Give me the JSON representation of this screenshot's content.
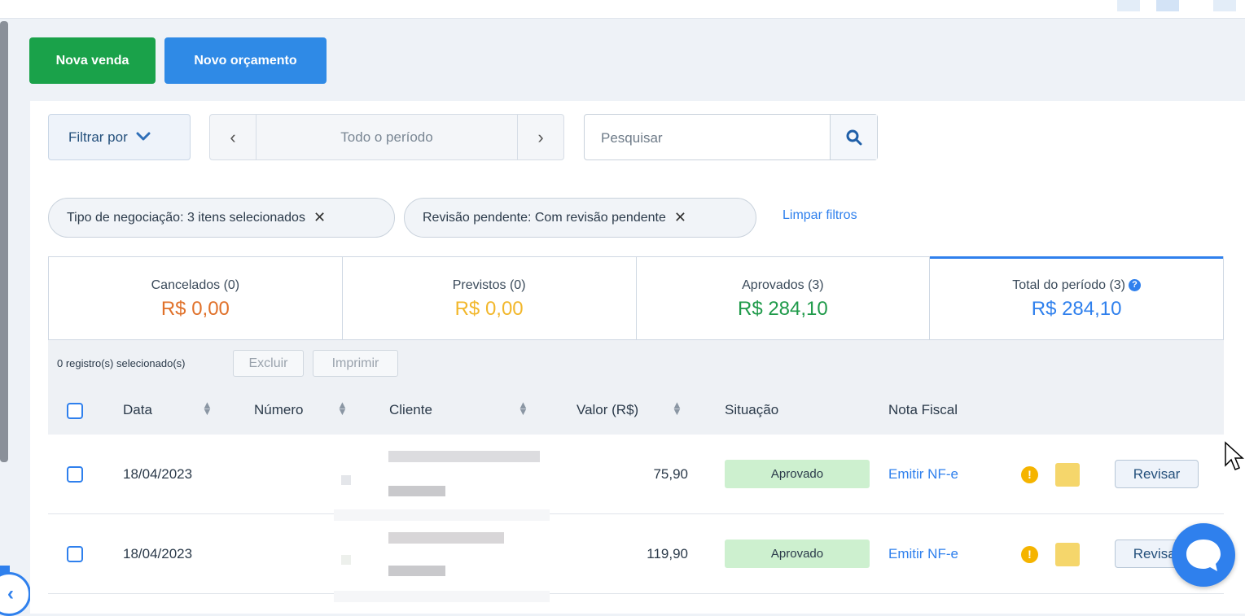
{
  "actions": {
    "new_sale": "Nova venda",
    "new_quote": "Novo orçamento"
  },
  "filters": {
    "filter_by": "Filtrar por",
    "period_label": "Todo o período",
    "search_placeholder": "Pesquisar",
    "chips": [
      {
        "label": "Tipo de negociação: 3 itens selecionados"
      },
      {
        "label": "Revisão pendente: Com revisão pendente"
      }
    ],
    "clear": "Limpar filtros"
  },
  "summary": [
    {
      "label": "Cancelados (0)",
      "value": "R$ 0,00",
      "color": "#e0712a"
    },
    {
      "label": "Previstos (0)",
      "value": "R$ 0,00",
      "color": "#f2b72b"
    },
    {
      "label": "Aprovados (3)",
      "value": "R$ 284,10",
      "color": "#1f9a4a"
    },
    {
      "label": "Total do período (3)",
      "value": "R$ 284,10",
      "color": "#2f80ed"
    }
  ],
  "bulk": {
    "selected": "0 registro(s) selecionado(s)",
    "delete": "Excluir",
    "print": "Imprimir"
  },
  "table": {
    "headers": {
      "date": "Data",
      "number": "Número",
      "client": "Cliente",
      "value": "Valor (R$)",
      "status": "Situação",
      "invoice": "Nota Fiscal"
    },
    "rows": [
      {
        "date": "18/04/2023",
        "value": "75,90",
        "status": "Aprovado",
        "invoice": "Emitir NF-e",
        "action": "Revisar"
      },
      {
        "date": "18/04/2023",
        "value": "119,90",
        "status": "Aprovado",
        "invoice": "Emitir NF-e",
        "action": "Revisar"
      }
    ]
  },
  "icons": {
    "sort": "sort-arrows-icon",
    "search": "search-icon",
    "warning": "warning-icon",
    "box": "package-icon",
    "chat": "chat-icon",
    "help": "question-circle-icon"
  }
}
